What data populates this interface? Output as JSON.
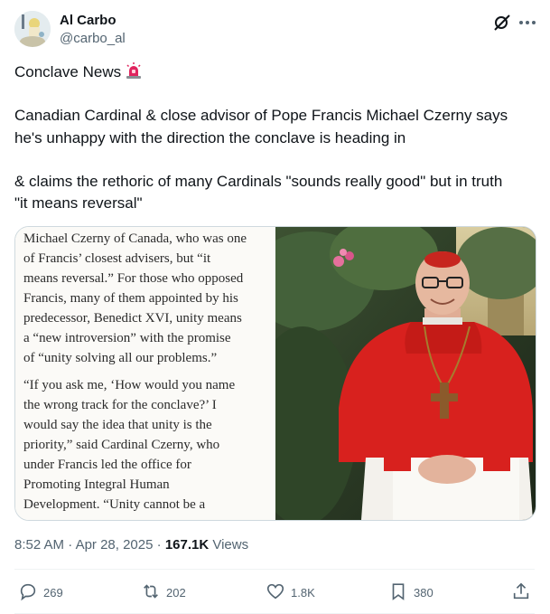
{
  "author": {
    "name": "Al Carbo",
    "handle": "@carbo_al"
  },
  "tweet": {
    "lines": [
      "Conclave News",
      "Canadian Cardinal & close advisor of Pope Francis Michael Czerny says",
      "he's unhappy with the direction the conclave is heading in",
      "& claims the rethoric of many Cardinals \"sounds really good\" but in truth",
      "\"it means reversal\""
    ]
  },
  "media": {
    "article_lines": [
      "Michael Czerny of Canada, who was one",
      "of Francis’ closest advisers, but “it",
      "means reversal.” For those who opposed",
      "Francis, many of them appointed by his",
      "predecessor, Benedict XVI, unity means",
      "a “new introversion” with the promise",
      "of “unity solving all our problems.”",
      "“If you ask me, ‘How would you name",
      "the wrong track for the conclave?’ I",
      "would say the idea that unity is the",
      "priority,” said Cardinal Czerny, who",
      "under Francis led the office for",
      "Promoting Integral Human",
      "Development. “Unity cannot be a"
    ]
  },
  "meta": {
    "time": "8:52 AM",
    "date": "Apr 28, 2025",
    "separator": "·",
    "views_count": "167.1K",
    "views_label": "Views"
  },
  "actions": {
    "replies": "269",
    "reposts": "202",
    "likes": "1.8K",
    "bookmarks": "380"
  },
  "icons": {
    "header": [
      "grok-icon",
      "more-icon"
    ],
    "actions": [
      "reply-icon",
      "repost-icon",
      "like-icon",
      "bookmark-icon",
      "share-icon"
    ],
    "emoji": "siren-icon"
  },
  "colors": {
    "text_primary": "#0f1419",
    "text_secondary": "#536471",
    "border": "#cfd9de",
    "cardinal_red": "#d8211e"
  }
}
